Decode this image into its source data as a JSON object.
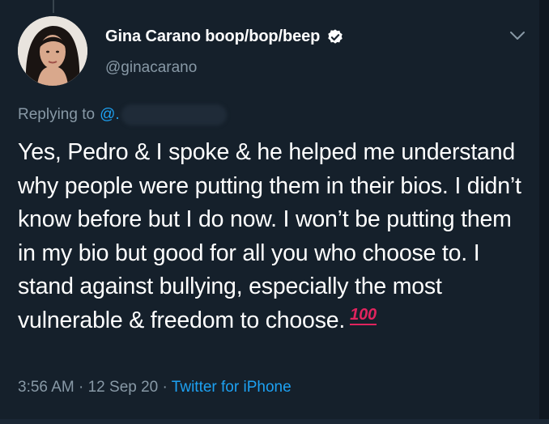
{
  "tweet": {
    "display_name": "Gina Carano boop/bop/beep",
    "handle": "@ginacarano",
    "reply_prefix": "Replying to",
    "reply_mention": "@.",
    "text": "Yes, Pedro & I spoke & he helped me understand why people were putting them in their bios. I didn’t know before but I do now. I won’t be putting them in my bio but good for all you who choose to. I stand against bullying, especially the most vulnerable & freedom to choose.",
    "emoji": "100",
    "time": "3:56 AM",
    "date": "12 Sep 20",
    "separator": "·",
    "source": "Twitter for iPhone"
  },
  "colors": {
    "background": "#15202b",
    "text": "#ffffff",
    "secondary": "#8899a6",
    "link": "#1da1f2",
    "emoji_red": "#e0245e"
  },
  "icons": {
    "verified": "verified-badge-icon",
    "caret": "chevron-down-icon"
  }
}
